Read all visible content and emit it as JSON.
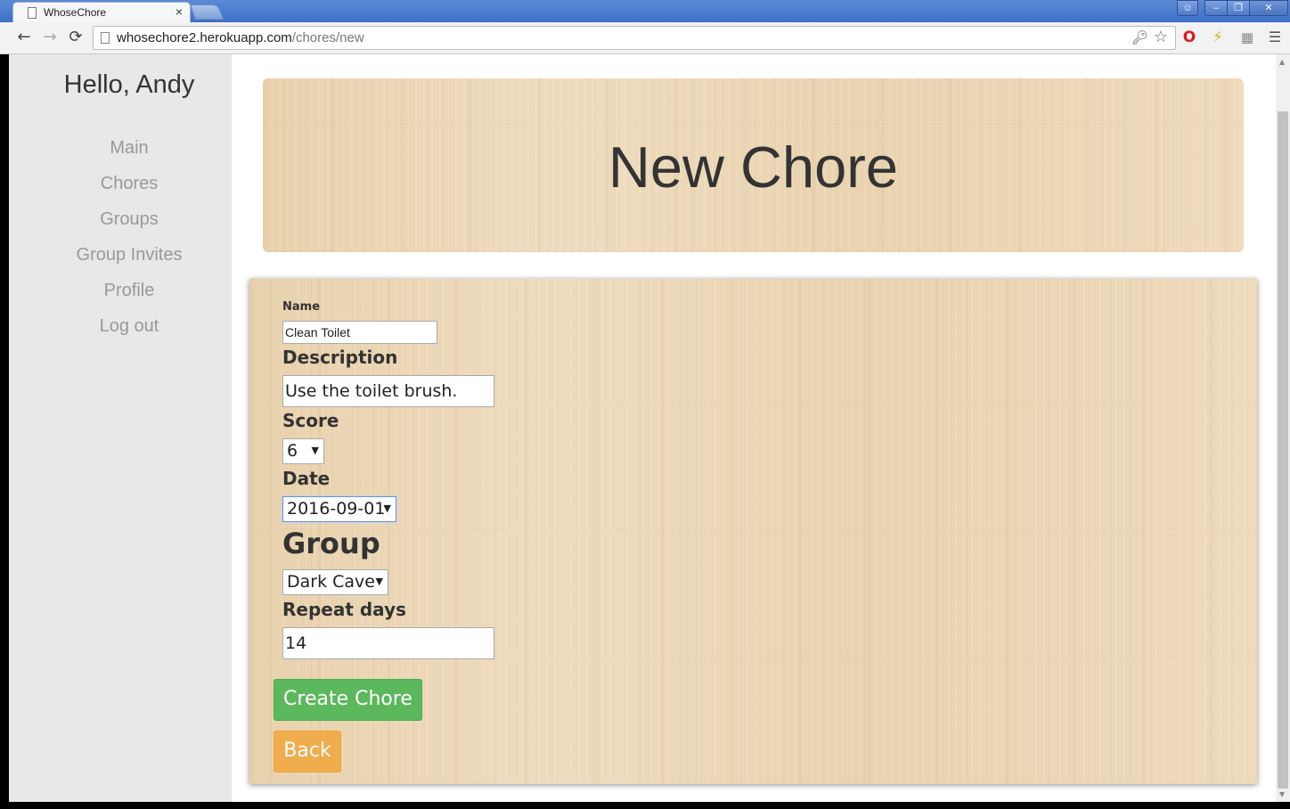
{
  "browser": {
    "tab_title": "WhoseChore",
    "tab_close": "×",
    "url_host": "whosechore2.herokuapp.com",
    "url_path": "/chores/new",
    "nav_back": "←",
    "nav_forward": "→",
    "nav_reload": "⟳",
    "icons": [
      "page-icon",
      "key-icon",
      "star-icon",
      "opera-icon",
      "bolt-icon",
      "extension-icon",
      "menu-icon"
    ]
  },
  "sidebar": {
    "greeting": "Hello, Andy",
    "items": [
      {
        "label": "Main"
      },
      {
        "label": "Chores"
      },
      {
        "label": "Groups"
      },
      {
        "label": "Group Invites"
      },
      {
        "label": "Profile"
      },
      {
        "label": "Log out"
      }
    ]
  },
  "header": {
    "title": "New Chore"
  },
  "form": {
    "name_label": "Name",
    "name_value": "Clean Toilet",
    "description_label": "Description",
    "description_value": "Use the toilet brush.",
    "score_label": "Score",
    "score_value": "6",
    "date_label": "Date",
    "date_value": "2016-09-01",
    "group_label": "Group",
    "group_value": "Dark Cave",
    "repeat_label": "Repeat days",
    "repeat_value": "14",
    "submit_label": "Create Chore",
    "back_label": "Back"
  },
  "colors": {
    "submit": "#5cb85c",
    "back": "#f0ad4e",
    "sidebar_bg": "#e8e8e8",
    "wood": "#ecd7b6"
  }
}
